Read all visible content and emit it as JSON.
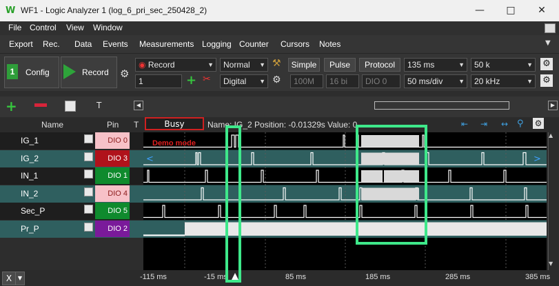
{
  "window": {
    "title": "WF1 - Logic Analyzer 1 (log_6_pri_sec_250428_2)"
  },
  "menubar": {
    "items": [
      "File",
      "Control",
      "View",
      "Window"
    ]
  },
  "submenu": {
    "items": [
      "Export",
      "Rec.",
      "Data",
      "Events",
      "Measurements",
      "Logging",
      "Counter",
      "Cursors",
      "Notes"
    ]
  },
  "toolbar": {
    "config_label": "Config",
    "record_label": "Record",
    "mode_select": "Record",
    "count_value": "1",
    "trigger_mode": "Normal",
    "source_mode": "Digital",
    "simple_label": "Simple",
    "pulse_label": "Pulse",
    "protocol_label": "Protocol",
    "rate_dim": "100M",
    "bits_dim": "16 bi",
    "dio_dim": "DIO 0",
    "duration": "135 ms",
    "time_div": "50 ms/div",
    "samples": "50 k",
    "freq": "20 kHz"
  },
  "sigbar": {
    "t_label": "T"
  },
  "header": {
    "name_col": "Name",
    "pin_col": "Pin",
    "t_col": "T",
    "status": "Busy",
    "info": "Name: IG_2  Position: -0.01329s  Value: 0"
  },
  "watermark": "Demo mode",
  "signals": [
    {
      "name": "IG_1",
      "pin": "DIO  0",
      "pin_color": "#f7c1c8",
      "pin_text": "#8a1a1a"
    },
    {
      "name": "IG_2",
      "pin": "DIO  3",
      "pin_color": "#b0121b",
      "pin_text": "#ffffff"
    },
    {
      "name": "IN_1",
      "pin": "DIO  1",
      "pin_color": "#0f8a2d",
      "pin_text": "#ffffff"
    },
    {
      "name": "IN_2",
      "pin": "DIO  4",
      "pin_color": "#f7c1c8",
      "pin_text": "#8a1a1a"
    },
    {
      "name": "Sec_P",
      "pin": "DIO  5",
      "pin_color": "#0f8a2d",
      "pin_text": "#ffffff"
    },
    {
      "name": "Pr_P",
      "pin": "DIO  2",
      "pin_color": "#7a1a9a",
      "pin_text": "#ffffff"
    }
  ],
  "time_ticks": [
    "-115 ms",
    "-15 ms",
    "85 ms",
    "185 ms",
    "285 ms",
    "385 ms"
  ],
  "colors": {
    "highlight": "#3ee88a",
    "trace": "#ffffff",
    "bus_fill": "#d9d9d9",
    "row_alt": "#2f5f5f"
  }
}
